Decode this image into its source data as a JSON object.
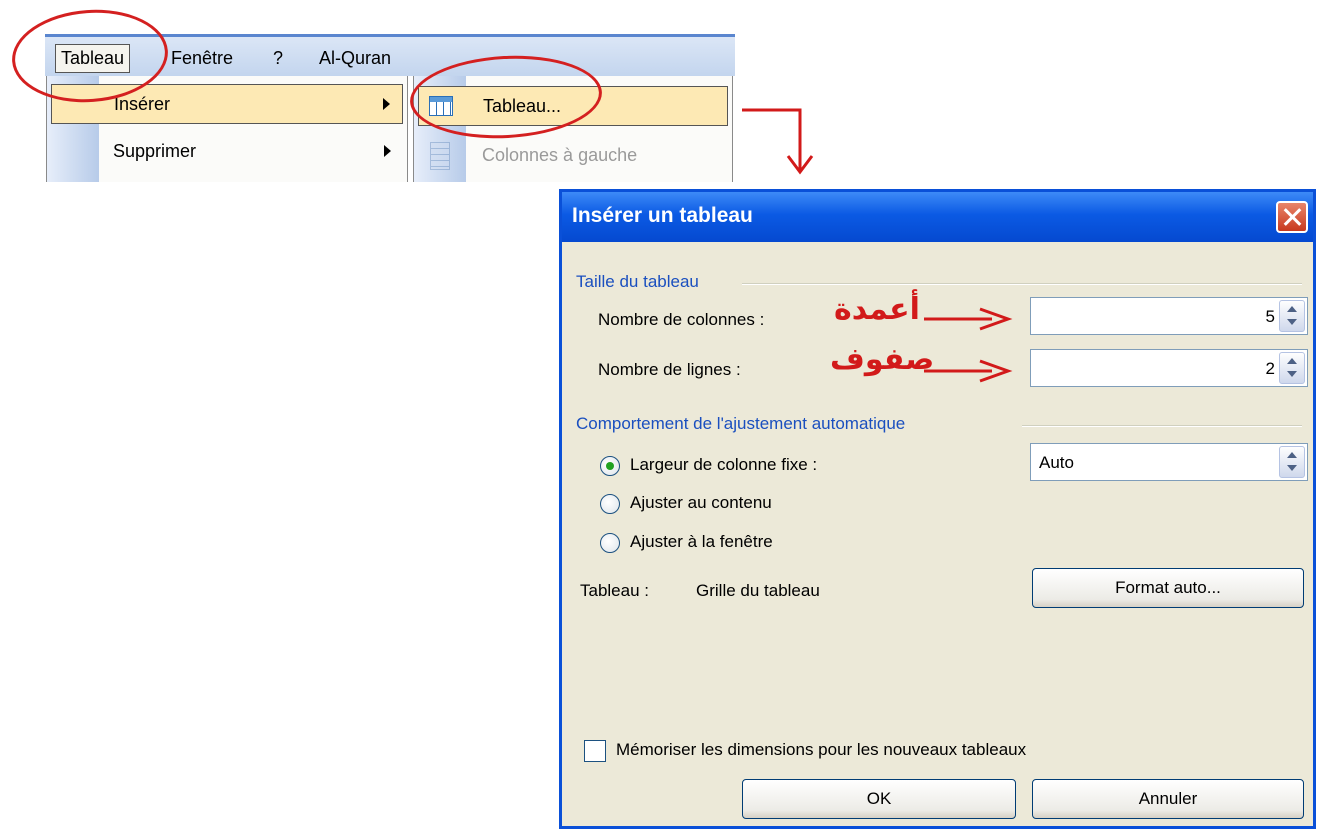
{
  "menubar": {
    "items": [
      "Tableau",
      "Fenêtre",
      "?",
      "Al-Quran"
    ]
  },
  "dropdown": {
    "items": [
      {
        "label": "Insérer",
        "has_submenu": true
      },
      {
        "label": "Supprimer",
        "has_submenu": true
      }
    ]
  },
  "submenu": {
    "items": [
      {
        "label": "Tableau...",
        "icon": "table-icon",
        "enabled": true
      },
      {
        "label": "Colonnes à gauche",
        "icon": "insert-columns-icon",
        "enabled": false
      }
    ]
  },
  "dialog": {
    "title": "Insérer un tableau",
    "size_group": {
      "title": "Taille du tableau",
      "columns_label": "Nombre de colonnes :",
      "columns_value": "5",
      "rows_label": "Nombre de lignes :",
      "rows_value": "2"
    },
    "autofit_group": {
      "title": "Comportement de l'ajustement automatique",
      "options": [
        {
          "label": "Largeur de colonne fixe :",
          "checked": true
        },
        {
          "label": "Ajuster au contenu",
          "checked": false
        },
        {
          "label": "Ajuster à la fenêtre",
          "checked": false
        }
      ],
      "fixed_width_value": "Auto"
    },
    "style": {
      "label": "Tableau :",
      "value": "Grille du tableau",
      "autoformat_button": "Format auto..."
    },
    "remember_label": "Mémoriser les dimensions pour les nouveaux tableaux",
    "remember_checked": false,
    "ok_button": "OK",
    "cancel_button": "Annuler"
  },
  "annotations": {
    "columns_arabic": "أعمدة",
    "rows_arabic": "صفوف",
    "color": "#d21a1a"
  }
}
